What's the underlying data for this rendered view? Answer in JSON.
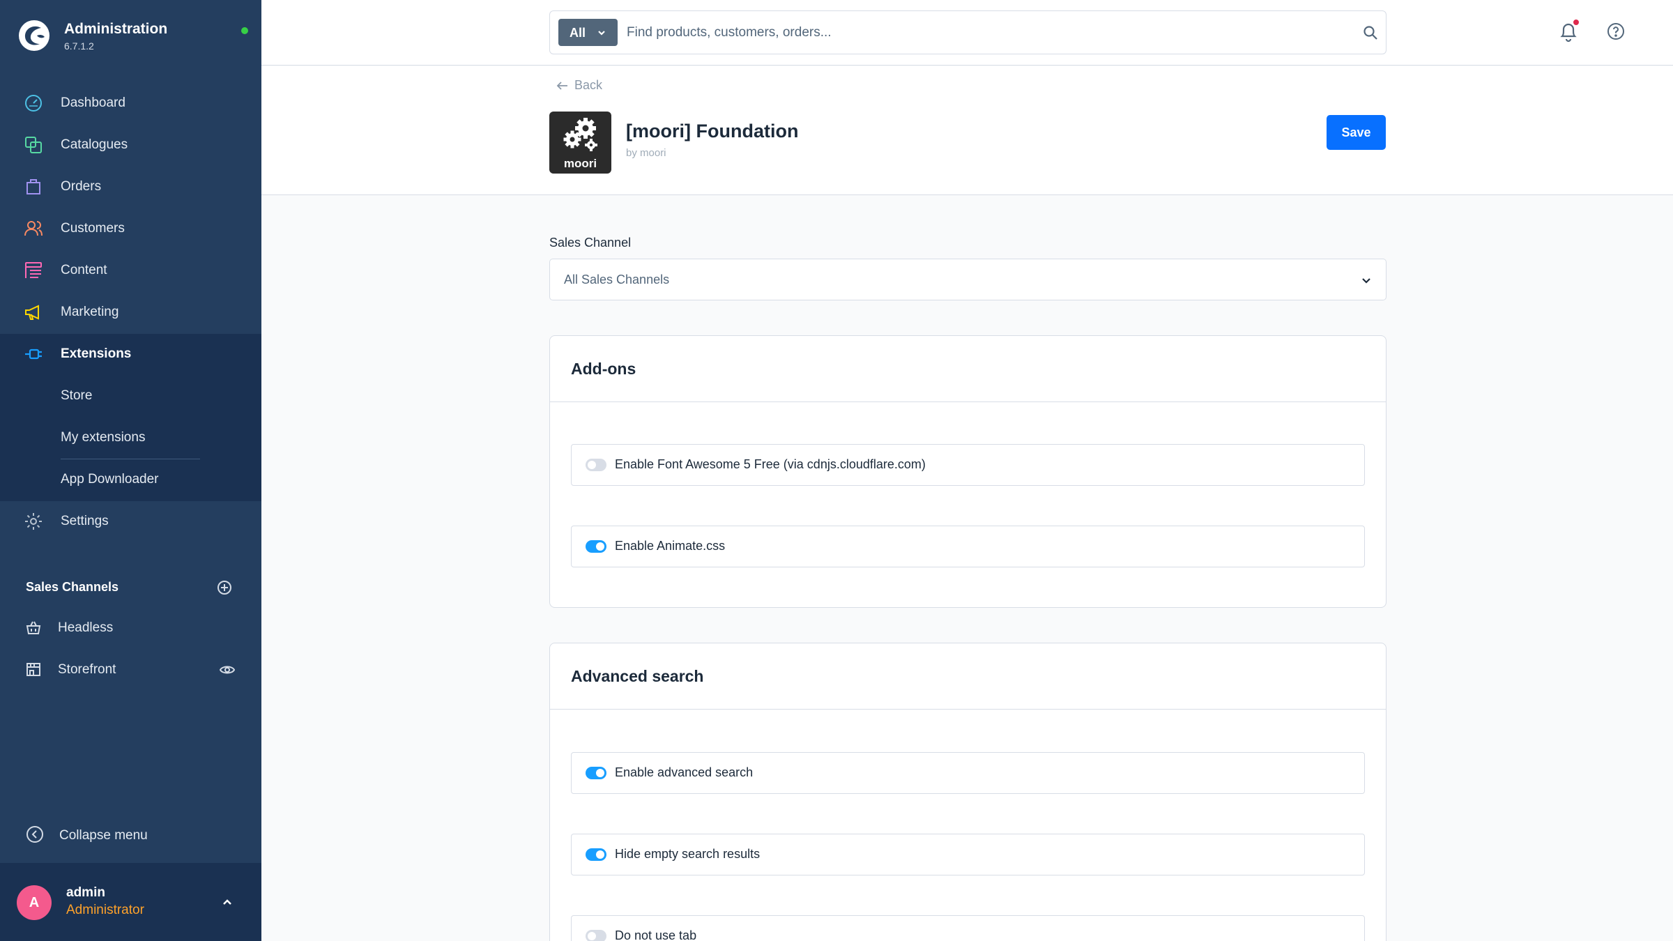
{
  "brand": {
    "title": "Administration",
    "version": "6.7.1.2"
  },
  "nav": {
    "items": [
      {
        "label": "Dashboard"
      },
      {
        "label": "Catalogues"
      },
      {
        "label": "Orders"
      },
      {
        "label": "Customers"
      },
      {
        "label": "Content"
      },
      {
        "label": "Marketing"
      },
      {
        "label": "Extensions"
      },
      {
        "label": "Settings"
      }
    ],
    "extensions_sub": [
      {
        "label": "Store"
      },
      {
        "label": "My extensions"
      },
      {
        "label": "App Downloader"
      }
    ]
  },
  "sales_channels": {
    "heading": "Sales Channels",
    "items": [
      {
        "label": "Headless"
      },
      {
        "label": "Storefront"
      }
    ]
  },
  "collapse_label": "Collapse menu",
  "user": {
    "initial": "A",
    "name": "admin",
    "role": "Administrator"
  },
  "search": {
    "type_label": "All",
    "placeholder": "Find products, customers, orders..."
  },
  "header": {
    "back_label": "Back",
    "plugin_logo_text": "moori",
    "plugin_name": "[moori] Foundation",
    "plugin_author": "by moori",
    "save_label": "Save"
  },
  "sales_channel_field": {
    "label": "Sales Channel",
    "value": "All Sales Channels"
  },
  "cards": [
    {
      "title": "Add-ons",
      "toggles": [
        {
          "label": "Enable Font Awesome 5 Free (via cdnjs.cloudflare.com)",
          "on": false
        },
        {
          "label": "Enable Animate.css",
          "on": true
        }
      ]
    },
    {
      "title": "Advanced search",
      "toggles": [
        {
          "label": "Enable advanced search",
          "on": true
        },
        {
          "label": "Hide empty search results",
          "on": true
        },
        {
          "label": "Do not use tab",
          "on": false
        }
      ]
    }
  ],
  "colors": {
    "sidebar": "#243e5f",
    "sidebar_active": "#1a3152",
    "accent": "#189eff",
    "save": "#0870ff",
    "status_online": "#37d046",
    "notification": "#de294c",
    "role": "#ffa22a"
  },
  "icons": {
    "nav": [
      "dashboard-icon",
      "catalogues-icon",
      "orders-icon",
      "customers-icon",
      "content-icon",
      "marketing-icon",
      "extensions-icon",
      "settings-icon"
    ],
    "channels": [
      "basket-icon",
      "storefront-icon"
    ]
  }
}
